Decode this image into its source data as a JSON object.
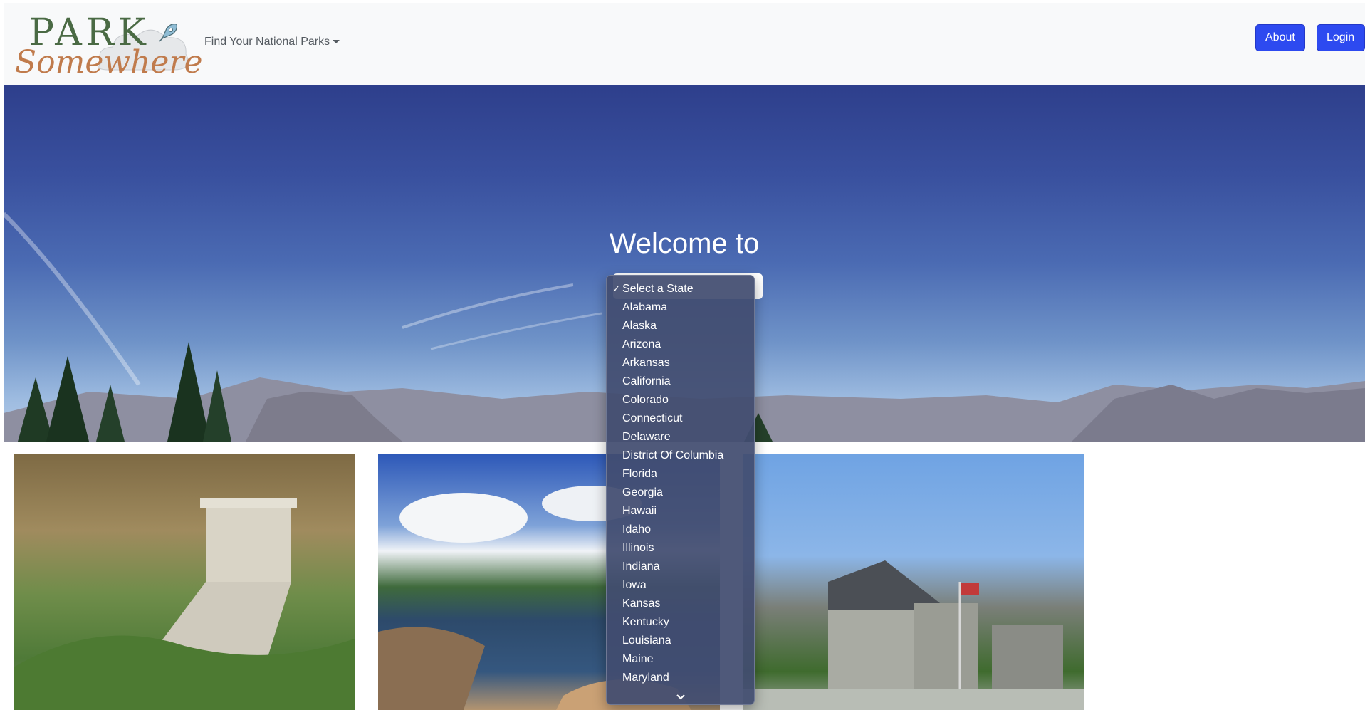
{
  "navbar": {
    "logo": {
      "line1": "PARK",
      "line2": "Somewhere"
    },
    "dropdown_label": "Find Your National Parks",
    "about_label": "About",
    "login_label": "Login"
  },
  "hero": {
    "title": "Welcome to"
  },
  "state_select": {
    "selected": "Select a State",
    "options": [
      "Select a State",
      "Alabama",
      "Alaska",
      "Arizona",
      "Arkansas",
      "California",
      "Colorado",
      "Connecticut",
      "Delaware",
      "District Of Columbia",
      "Florida",
      "Georgia",
      "Hawaii",
      "Idaho",
      "Illinois",
      "Indiana",
      "Iowa",
      "Kansas",
      "Kentucky",
      "Louisiana",
      "Maine",
      "Maryland"
    ]
  },
  "icons": {
    "caret": "caret-down-icon",
    "check": "checkmark-icon",
    "scroll": "chevron-down-icon",
    "rocket": "rocket-icon"
  },
  "colors": {
    "accent": "#2d4af0",
    "navbar_bg": "#f8f9fa",
    "logo_green": "#4a6a44",
    "logo_orange": "#c07b4c"
  }
}
